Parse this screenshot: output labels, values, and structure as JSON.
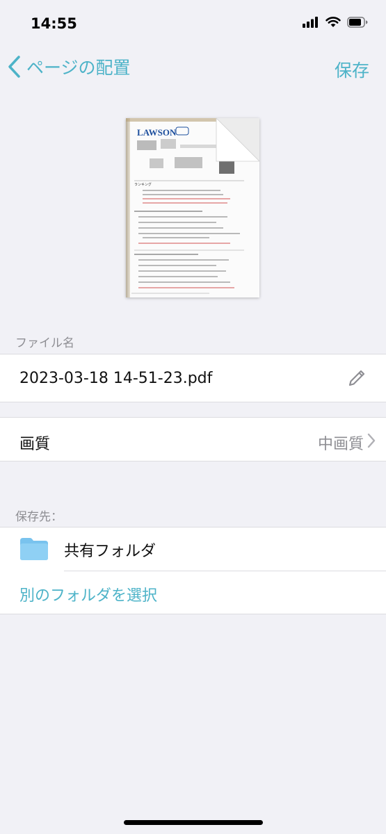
{
  "status_bar": {
    "time": "14:55"
  },
  "nav": {
    "back_title": "ページの配置",
    "save_label": "保存"
  },
  "preview": {
    "doc_logo": "LAWSON",
    "doc_title": "ランキング"
  },
  "file_section": {
    "label": "ファイル名",
    "filename": "2023-03-18 14-51-23.pdf"
  },
  "quality": {
    "label": "画質",
    "value": "中画質"
  },
  "destination": {
    "label": "保存先：",
    "folder_name": "共有フォルダ",
    "choose_label": "別のフォルダを選択"
  },
  "colors": {
    "accent": "#4db3c8",
    "folder": "#79c3ee",
    "background": "#f1f1f6"
  }
}
